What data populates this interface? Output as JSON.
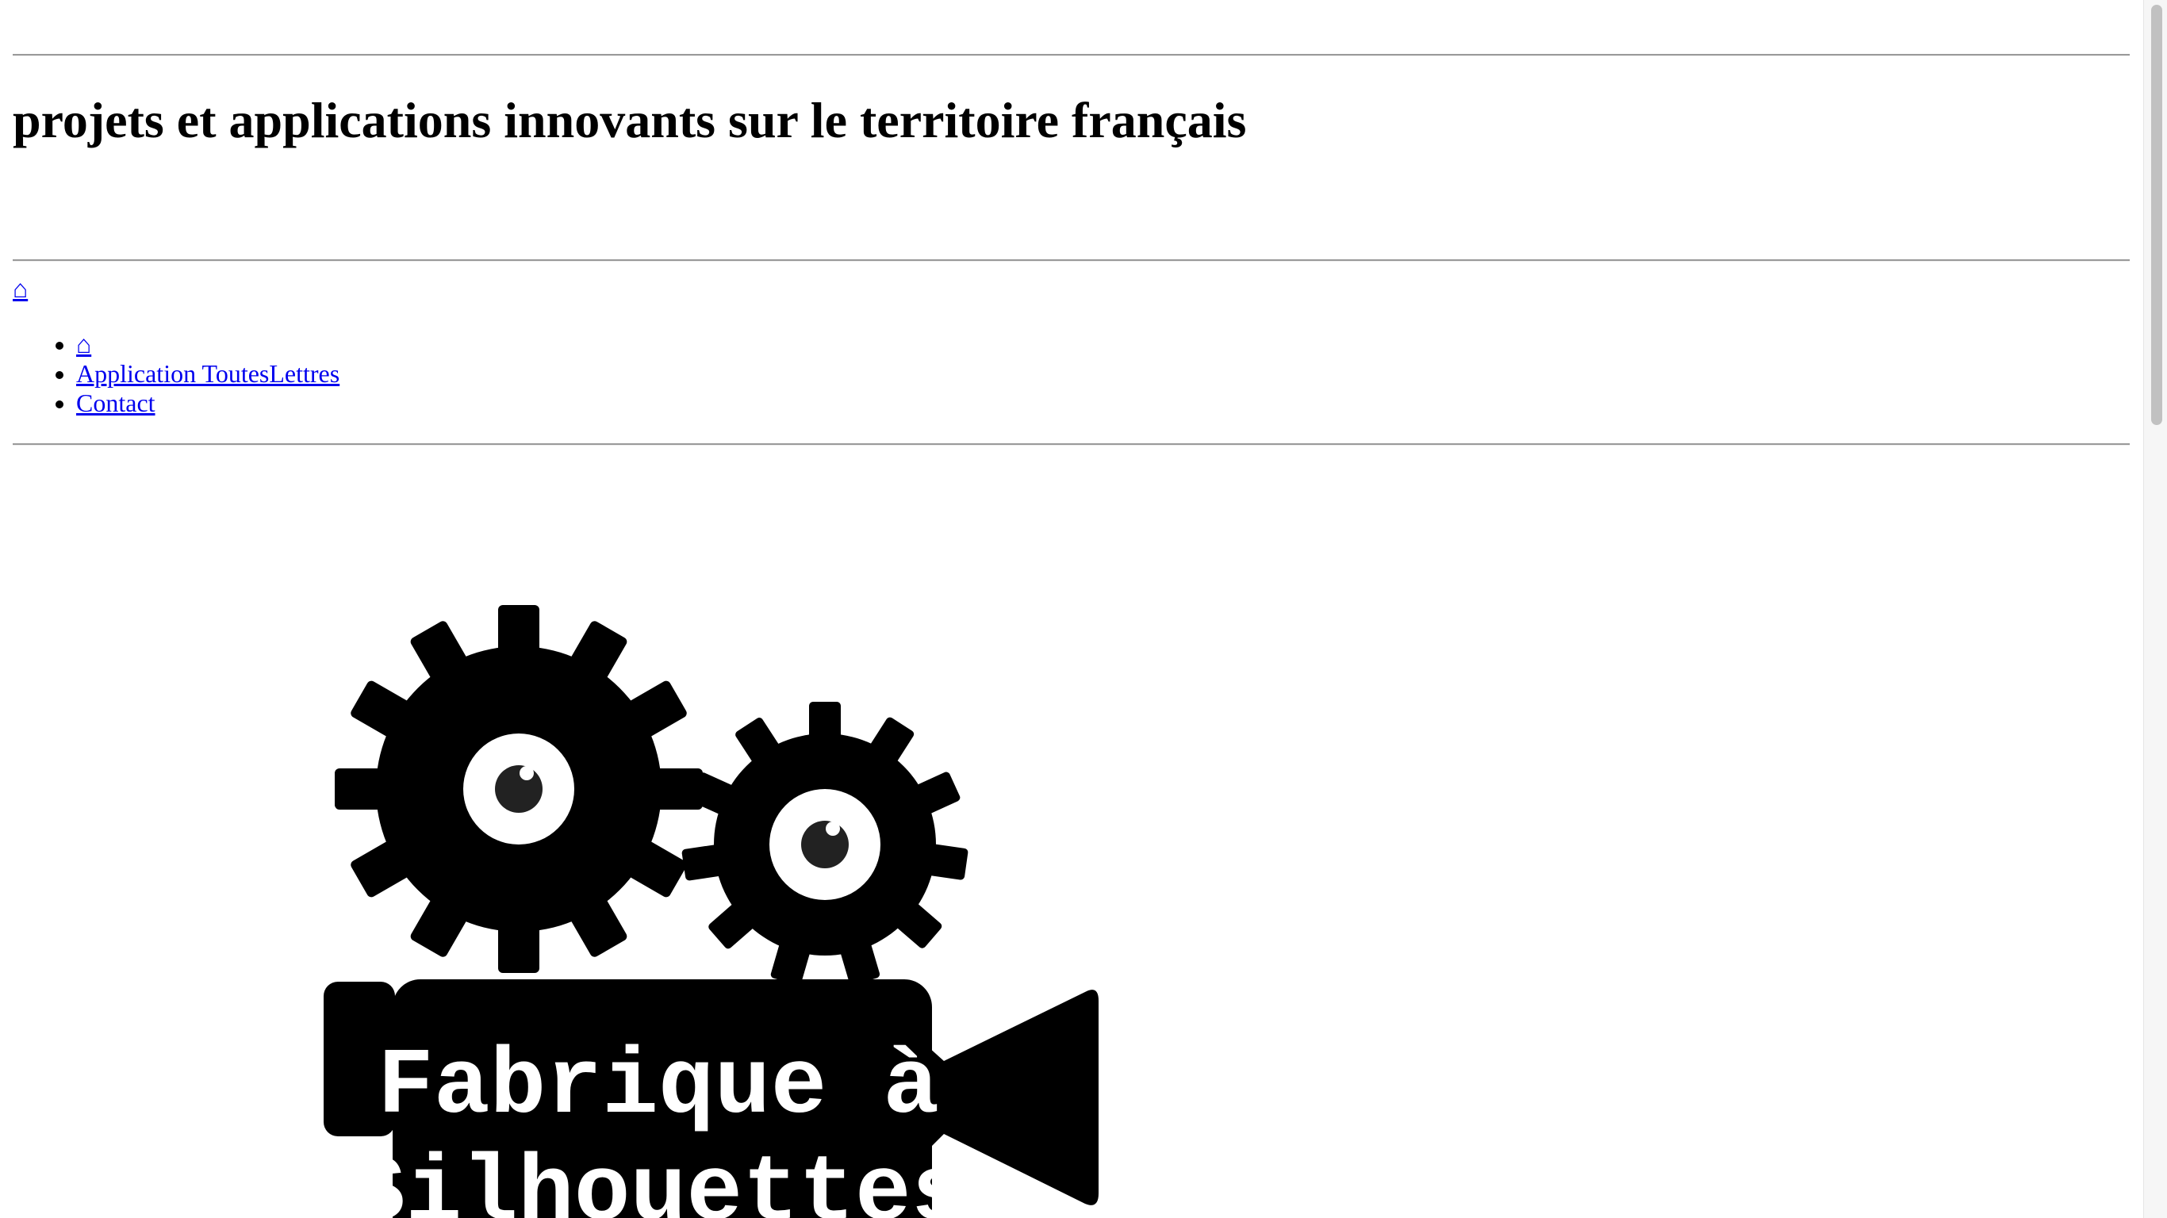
{
  "header": {
    "tagline": "projets et applications innovants sur le territoire français"
  },
  "nav": {
    "home_icon_glyph": "⌂",
    "items": [
      {
        "label": "⌂",
        "icon": "home-icon"
      },
      {
        "label": "Application ToutesLettres"
      },
      {
        "label": "Contact"
      }
    ]
  },
  "logo": {
    "line1": "Fabrique à",
    "line2": "Silhouettes"
  },
  "colors": {
    "link": "#0000ee",
    "rule": "#9a9a9a",
    "logo": "#000000"
  }
}
